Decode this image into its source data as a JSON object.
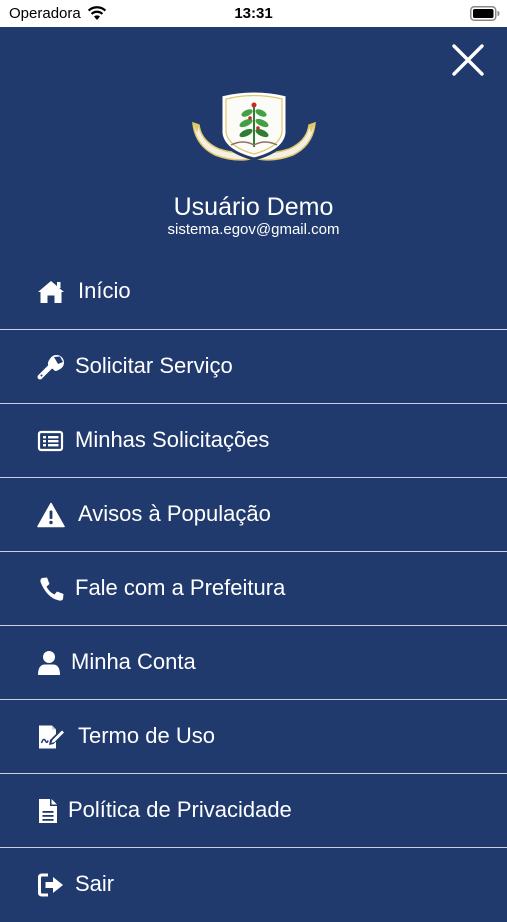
{
  "status_bar": {
    "carrier": "Operadora",
    "time": "13:31",
    "icons": [
      "wifi-icon",
      "battery-icon"
    ]
  },
  "drawer": {
    "background_color": "#213a6e",
    "close_icon": "close-icon",
    "crest_icon": "municipal-crest-icon",
    "user": {
      "name": "Usuário Demo",
      "email": "sistema.egov@gmail.com"
    },
    "menu": [
      {
        "label": "Início",
        "icon": "home-icon"
      },
      {
        "label": "Solicitar Serviço",
        "icon": "wrench-icon"
      },
      {
        "label": "Minhas Solicitações",
        "icon": "list-icon"
      },
      {
        "label": "Avisos à População",
        "icon": "warning-icon"
      },
      {
        "label": "Fale com a Prefeitura",
        "icon": "phone-icon"
      },
      {
        "label": "Minha Conta",
        "icon": "user-icon"
      },
      {
        "label": "Termo de Uso",
        "icon": "signature-icon"
      },
      {
        "label": "Política de Privacidade",
        "icon": "document-icon"
      },
      {
        "label": "Sair",
        "icon": "sign-out-icon"
      }
    ]
  }
}
